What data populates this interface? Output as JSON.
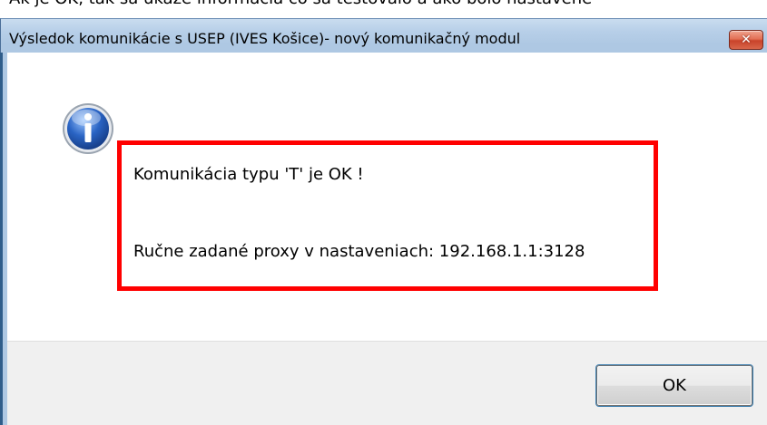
{
  "background_text": "Ak je OK, tak sa ukáže informácia čo sa testovalo a ako bolo nastavené",
  "window": {
    "title": "Výsledok komunikácie s USEP (IVES Košice)- nový komunikačný modul",
    "close_label": "✕"
  },
  "message": {
    "icon": "info-icon",
    "line1": "Komunikácia typu 'T' je OK !",
    "line2": "Ručne zadané proxy v nastaveniach: 192.168.1.1:3128"
  },
  "buttons": {
    "ok_label": "OK"
  },
  "colors": {
    "highlight": "#ff0000",
    "titlebar": "#b7cfe8",
    "info_icon": "#2a64c4"
  }
}
